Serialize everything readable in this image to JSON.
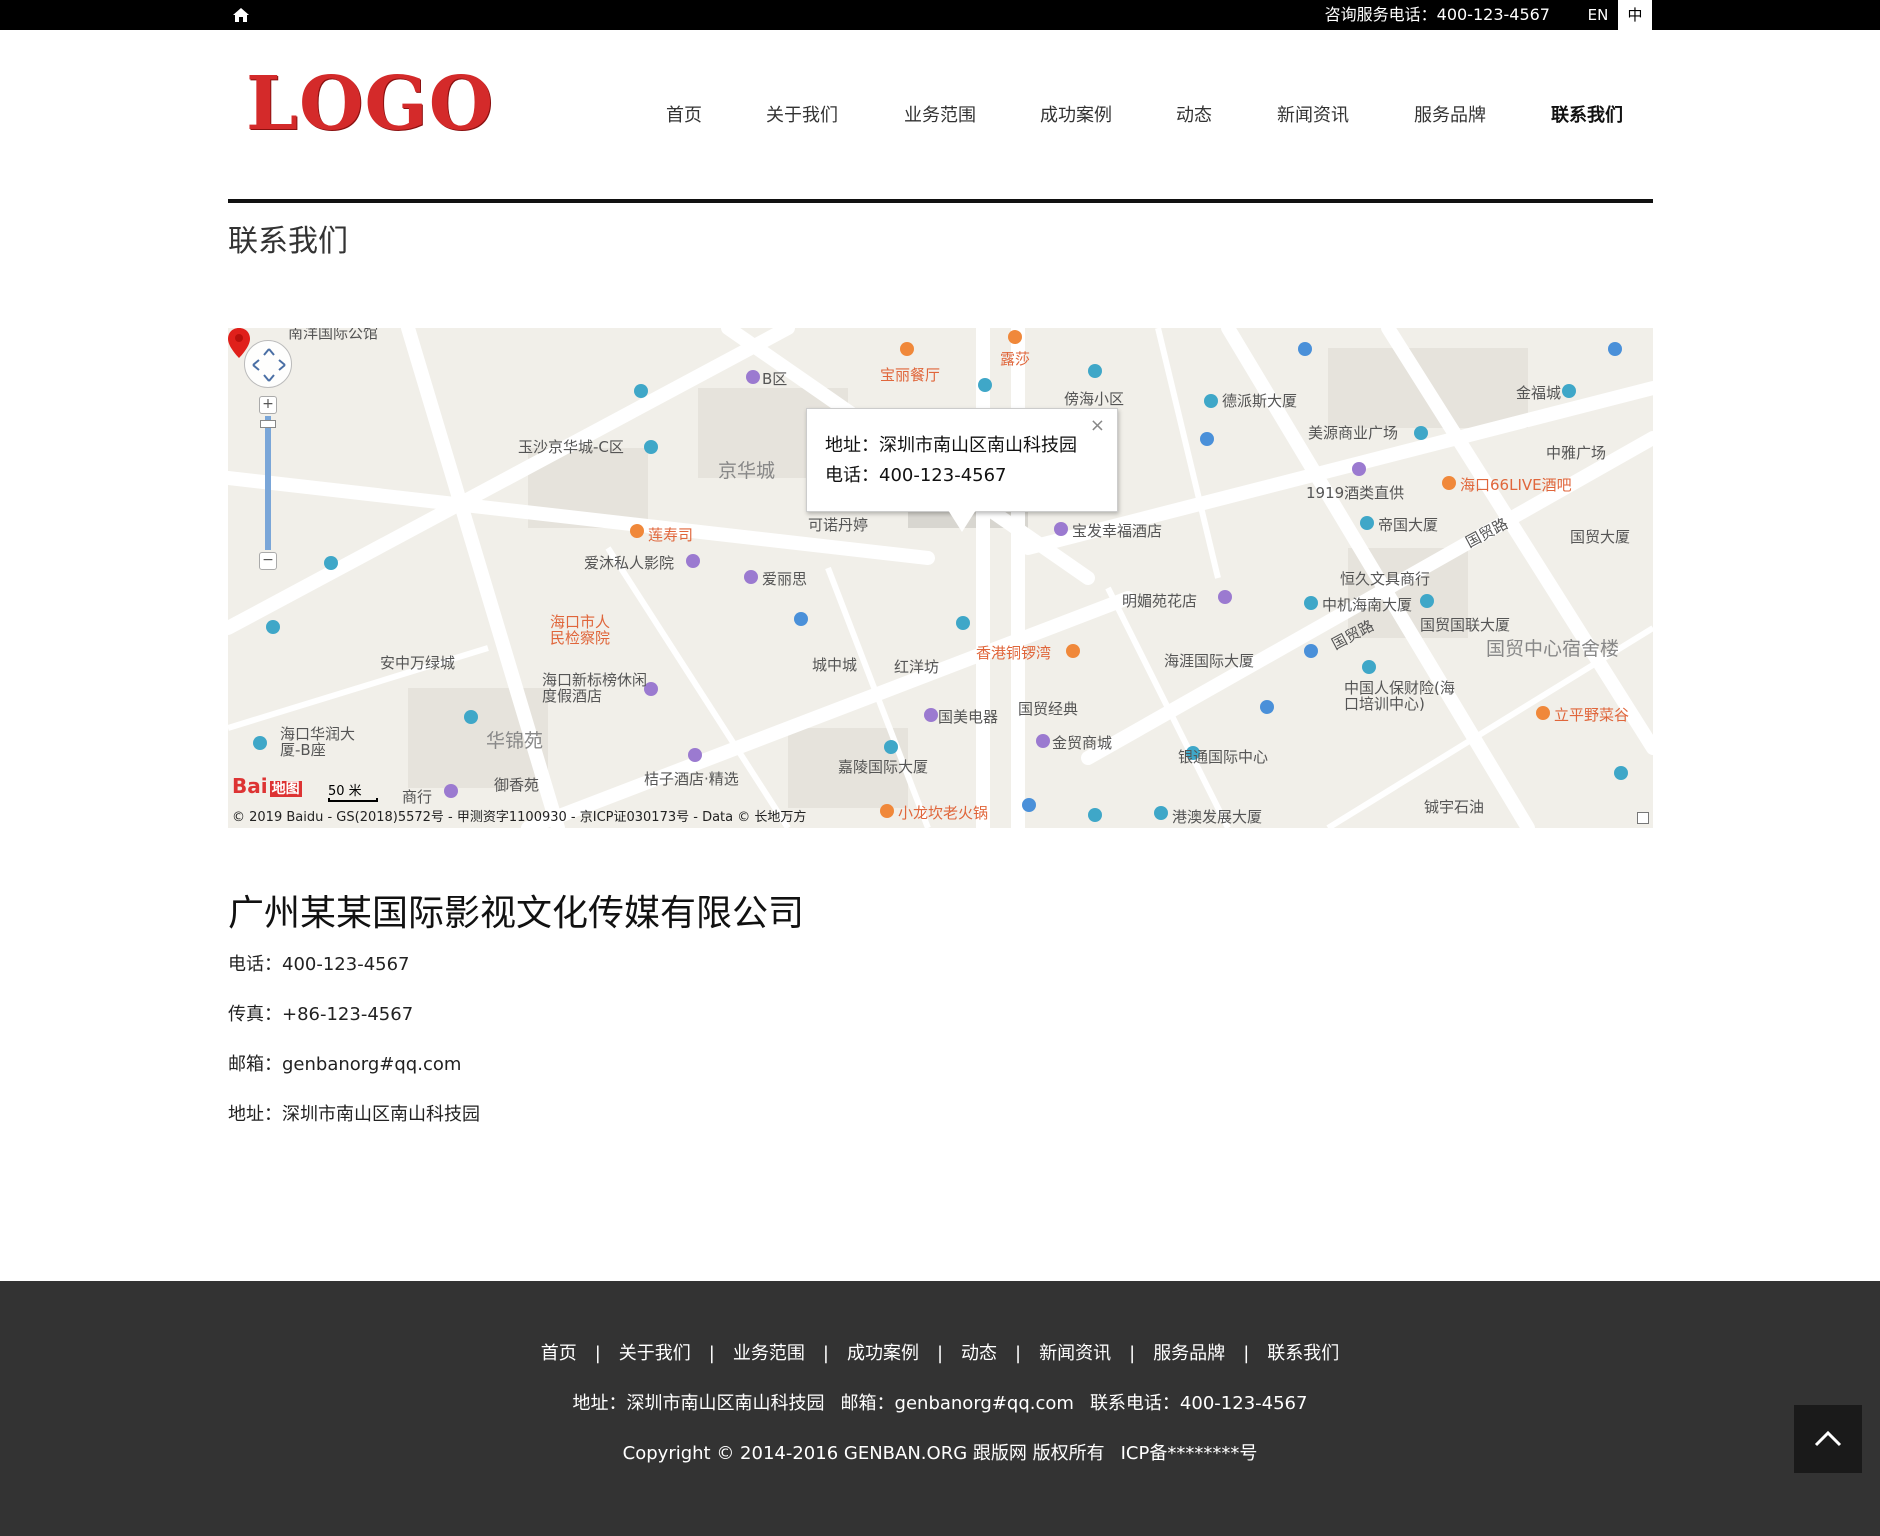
{
  "topbar": {
    "hotline_label": "咨询服务电话：400-123-4567",
    "lang_en": "EN",
    "lang_zh": "中"
  },
  "header": {
    "logo_text": "LOGO",
    "nav": [
      {
        "label": "首页"
      },
      {
        "label": "关于我们"
      },
      {
        "label": "业务范围"
      },
      {
        "label": "成功案例"
      },
      {
        "label": "动态"
      },
      {
        "label": "新闻资讯"
      },
      {
        "label": "服务品牌"
      },
      {
        "label": "联系我们"
      }
    ]
  },
  "page": {
    "title": "联系我们"
  },
  "map": {
    "infowindow": {
      "address": "地址：深圳市南山区南山科技园",
      "phone": "电话：400-123-4567",
      "close": "×"
    },
    "labels": {
      "l01": "南洋国际公馆",
      "l02": "B区",
      "l03": "宝丽餐厅",
      "l04": "露莎",
      "l05": "傍海小区",
      "l06": "德派斯大厦",
      "l07": "金福城",
      "l08": "美源商业广场",
      "l09": "中雅广场",
      "l10": "玉沙京华城-C区",
      "l11": "京华城",
      "l12": "1919酒类直供",
      "l13": "海口66LIVE酒吧",
      "l14": "帝国大厦",
      "l15": "国贸大厦",
      "l16": "莲寿司",
      "l17": "可诺丹婷",
      "l18": "宝发幸福酒店",
      "l19": "国贸路",
      "l20": "爱沐私人影院",
      "l21": "爱丽思",
      "l22": "恒久文具商行",
      "l23": "明媚苑花店",
      "l24": "中机海南大厦",
      "l25": "海口市人民检察院",
      "l26": "国贸国联大厦",
      "l27": "国贸中心宿舍楼",
      "l28": "安中万绿城",
      "l29": "城中城",
      "l30": "红洋坊",
      "l31": "香港铜锣湾",
      "l32": "海涯国际大厦",
      "l33": "海口新标榜休闲度假酒店",
      "l34": "中国人保财险(海口培训中心)",
      "l35": "立平野菜谷",
      "l36": "国美电器",
      "l37": "国贸经典",
      "l38": "华锦苑",
      "l39": "海口华润大厦-B座",
      "l40": "金贸商城",
      "l41": "银通国际中心",
      "l42": "嘉陵国际大厦",
      "l43": "桔子酒店·精选",
      "l44": "御香苑",
      "l45": "商行",
      "l46": "小龙坎老火锅",
      "l47": "港澳发展大厦",
      "l48": "铖宇石油",
      "l49": "国贸路"
    },
    "baidu_logo": "Bai",
    "baidu_logo_map": "地图",
    "scale_label": "50 米",
    "copyright": "© 2019 Baidu - GS(2018)5572号 - 甲测资字1100930 - 京ICP证030173号 - Data © 长地万方",
    "zoom_in": "+",
    "zoom_out": "−"
  },
  "company": {
    "name": "广州某某国际影视文化传媒有限公司",
    "phone": "电话：400-123-4567",
    "fax": "传真：+86-123-4567",
    "email": "邮箱：genbanorg#qq.com",
    "address": "地址：深圳市南山区南山科技园"
  },
  "footer": {
    "nav": [
      {
        "label": "首页"
      },
      {
        "label": "关于我们"
      },
      {
        "label": "业务范围"
      },
      {
        "label": "成功案例"
      },
      {
        "label": "动态"
      },
      {
        "label": "新闻资讯"
      },
      {
        "label": "服务品牌"
      },
      {
        "label": "联系我们"
      }
    ],
    "separator": "|",
    "address": "地址：深圳市南山区南山科技园",
    "email": "邮箱：genbanorg#qq.com",
    "phone": "联系电话：400-123-4567",
    "copyright": "Copyright © 2014-2016 GENBAN.ORG 跟版网 版权所有",
    "icp": "ICP备********号"
  },
  "colors": {
    "logo_red": "#d42a2a",
    "footer_bg": "#333333",
    "topbar_bg": "#000000",
    "map_bg": "#f1efe9"
  }
}
